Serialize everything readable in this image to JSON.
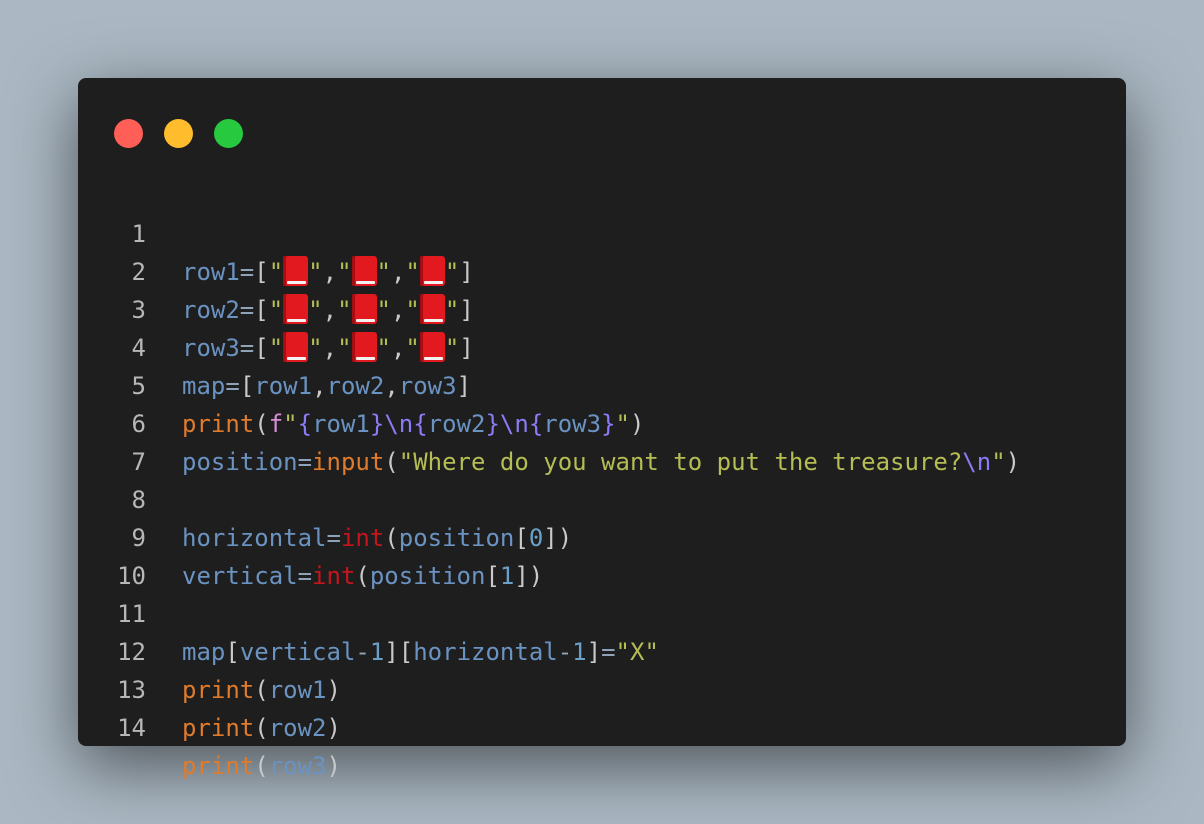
{
  "window": {
    "controls": [
      "close",
      "minimize",
      "maximize"
    ]
  },
  "editor": {
    "line_numbers": [
      "1",
      "2",
      "3",
      "4",
      "5",
      "6",
      "7",
      "8",
      "9",
      "10",
      "11",
      "12",
      "13",
      "14"
    ],
    "book_emoji": "📕",
    "code": {
      "row1": "row1",
      "row2": "row2",
      "row3": "row3",
      "map": "map",
      "print": "print",
      "position": "position",
      "input": "input",
      "horizontal": "horizontal",
      "vertical": "vertical",
      "int": "int",
      "fprefix": "f",
      "prompt_text": "Where do you want to put the treasure?",
      "newline_escape": "\\n",
      "index_0": "0",
      "index_1": "1",
      "one": "1",
      "x_value": "X"
    }
  },
  "colors": {
    "background": "#abb8c3",
    "window": "#1e1e1e",
    "close": "#ff5f56",
    "minimize": "#ffbd2e",
    "maximize": "#27c93f"
  }
}
